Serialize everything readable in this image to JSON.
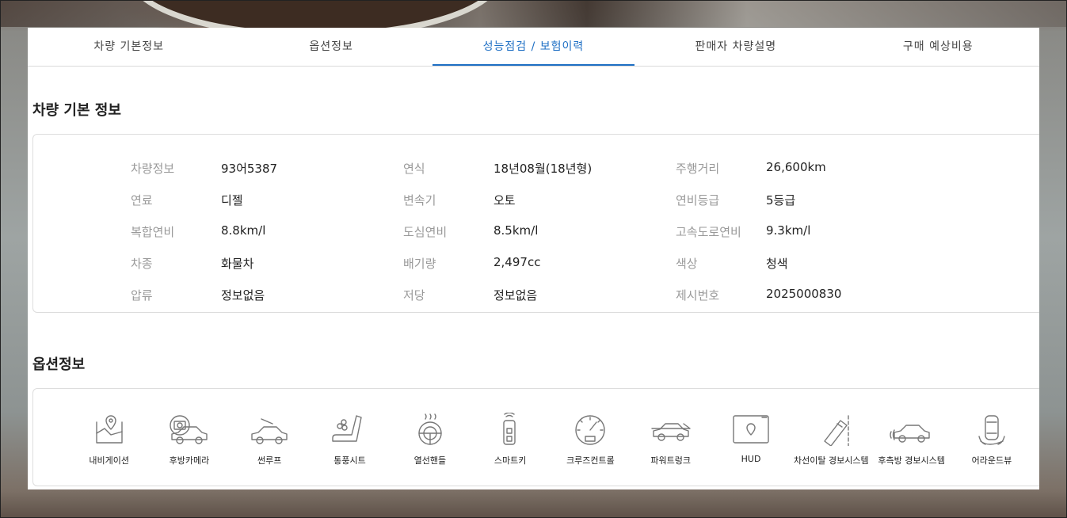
{
  "tabs": [
    {
      "label": "차량 기본정보",
      "active": false
    },
    {
      "label": "옵션정보",
      "active": false
    },
    {
      "label": "성능점검 / 보험이력",
      "active": true
    },
    {
      "label": "판매자 차량설명",
      "active": false
    },
    {
      "label": "구매 예상비용",
      "active": false
    }
  ],
  "basic_info": {
    "title": "차량 기본 정보",
    "rows": [
      [
        {
          "label": "차량정보",
          "value": "93어5387"
        },
        {
          "label": "연식",
          "value": "18년08월(18년형)"
        },
        {
          "label": "주행거리",
          "value": "26,600km"
        }
      ],
      [
        {
          "label": "연료",
          "value": "디젤"
        },
        {
          "label": "변속기",
          "value": "오토"
        },
        {
          "label": "연비등급",
          "value": "5등급"
        }
      ],
      [
        {
          "label": "복합연비",
          "value": "8.8km/l"
        },
        {
          "label": "도심연비",
          "value": "8.5km/l"
        },
        {
          "label": "고속도로연비",
          "value": "9.3km/l"
        }
      ],
      [
        {
          "label": "차종",
          "value": "화물차"
        },
        {
          "label": "배기량",
          "value": "2,497cc"
        },
        {
          "label": "색상",
          "value": "청색"
        }
      ],
      [
        {
          "label": "압류",
          "value": "정보없음"
        },
        {
          "label": "저당",
          "value": "정보없음"
        },
        {
          "label": "제시번호",
          "value": "2025000830"
        }
      ]
    ]
  },
  "options": {
    "title": "옵션정보",
    "items": [
      {
        "label": "내비게이션",
        "icon": "navigation-icon"
      },
      {
        "label": "후방카메라",
        "icon": "rear-camera-icon"
      },
      {
        "label": "썬루프",
        "icon": "sunroof-icon"
      },
      {
        "label": "통풍시트",
        "icon": "ventilated-seat-icon"
      },
      {
        "label": "열선핸들",
        "icon": "heated-steering-icon"
      },
      {
        "label": "스마트키",
        "icon": "smart-key-icon"
      },
      {
        "label": "크루즈컨트롤",
        "icon": "cruise-control-icon"
      },
      {
        "label": "파워트렁크",
        "icon": "power-trunk-icon"
      },
      {
        "label": "HUD",
        "icon": "hud-icon"
      },
      {
        "label": "차선이탈 경보시스템",
        "icon": "lane-departure-icon"
      },
      {
        "label": "후측방 경보시스템",
        "icon": "blind-spot-icon"
      },
      {
        "label": "어라운드뷰",
        "icon": "around-view-icon"
      }
    ]
  }
}
